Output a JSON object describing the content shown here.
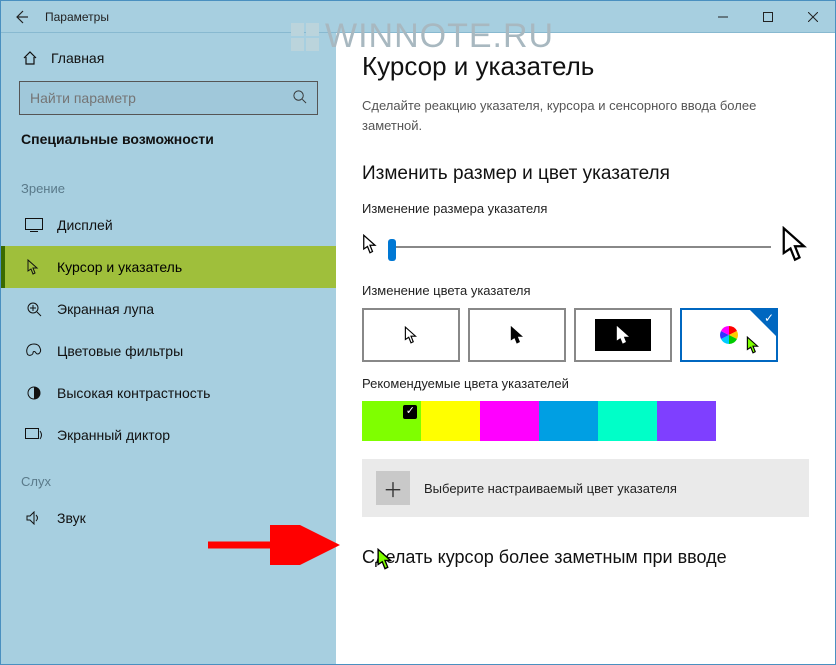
{
  "window": {
    "title": "Параметры"
  },
  "watermark": "WINNOTE.RU",
  "sidebar": {
    "home": "Главная",
    "search_placeholder": "Найти параметр",
    "category": "Специальные возможности",
    "groups": {
      "vision": "Зрение",
      "hearing": "Слух"
    },
    "items": {
      "display": "Дисплей",
      "cursor": "Курсор и указатель",
      "magnifier": "Экранная лупа",
      "filters": "Цветовые фильтры",
      "contrast": "Высокая контрастность",
      "narrator": "Экранный диктор",
      "sound": "Звук"
    }
  },
  "content": {
    "h1": "Курсор и указатель",
    "desc": "Сделайте реакцию указателя, курсора и сенсорного ввода более заметной.",
    "h2_size": "Изменить размер и цвет указателя",
    "label_size": "Изменение размера указателя",
    "label_color": "Изменение цвета указателя",
    "label_rec": "Рекомендуемые цвета указателей",
    "custom_label": "Выберите настраиваемый цвет указателя",
    "h2_visible": "Сделать курсор более заметным при вводе"
  },
  "rec_colors": [
    "#7fff00",
    "#ffff00",
    "#ff00ff",
    "#009fe3",
    "#00ffc8",
    "#7f3fff"
  ],
  "selected_rec_index": 0
}
